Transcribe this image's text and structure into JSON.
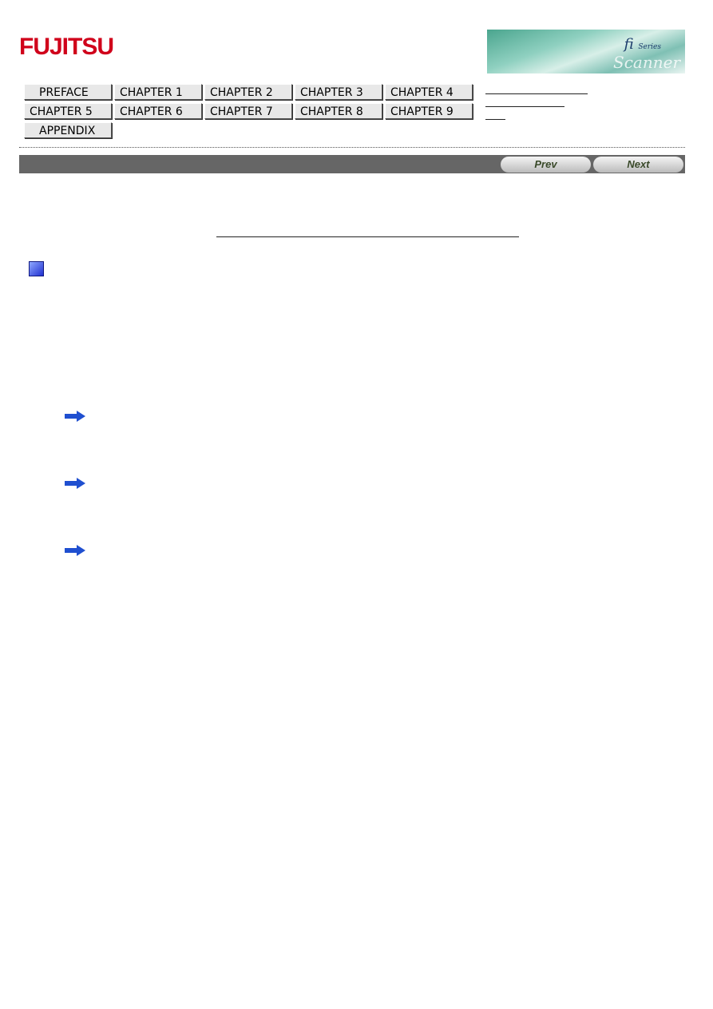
{
  "logo": "FUJITSU",
  "banner": {
    "fi": "fi",
    "series": "Series",
    "scanner": "Scanner"
  },
  "nav": [
    "PREFACE",
    "CHAPTER 1",
    "CHAPTER 2",
    "CHAPTER 3",
    "CHAPTER 4",
    "CHAPTER 5",
    "CHAPTER 6",
    "CHAPTER 7",
    "CHAPTER 8",
    "CHAPTER 9",
    "APPENDIX"
  ],
  "pager": {
    "prev": "Prev",
    "next": "Next"
  },
  "colors": {
    "header_bar": "#666666",
    "bullet": "#2030d0",
    "arrow": "#1f4fd0"
  }
}
